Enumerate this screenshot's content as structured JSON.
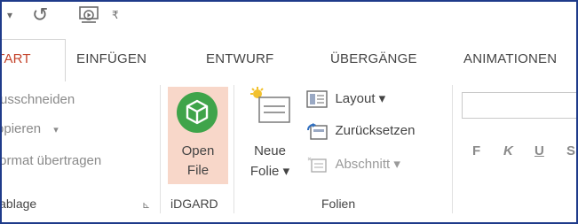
{
  "qat": {
    "icons": [
      "dropdown-caret-icon",
      "undo-icon",
      "start-from-beginning-icon",
      "customize-qat-icon"
    ]
  },
  "tabs": [
    {
      "label": "START",
      "active": true
    },
    {
      "label": "EINFÜGEN"
    },
    {
      "label": "ENTWURF"
    },
    {
      "label": "ÜBERGÄNGE"
    },
    {
      "label": "ANIMATIONEN"
    }
  ],
  "clipboard": {
    "cut_label": "Ausschneiden",
    "copy_label": "Kopieren",
    "copy_caret": "▾",
    "format_label": "Format übertragen",
    "group_label": "Zwischenablage"
  },
  "idgard": {
    "open_file_line1": "Open",
    "open_file_line2": "File",
    "group_label": "iDGARD"
  },
  "slides": {
    "new_slide_line1": "Neue",
    "new_slide_line2": "Folie ▾",
    "layout_label": "Layout ▾",
    "reset_label": "Zurücksetzen",
    "section_label": "Abschnitt ▾",
    "group_label": "Folien"
  },
  "font": {
    "bold": "F",
    "italic": "K",
    "underline": "U",
    "shadow": "S"
  },
  "colors": {
    "accent_active_tab": "#c4432b",
    "idgard_highlight": "#f8d7c9",
    "idgard_icon": "#3fa44a"
  }
}
